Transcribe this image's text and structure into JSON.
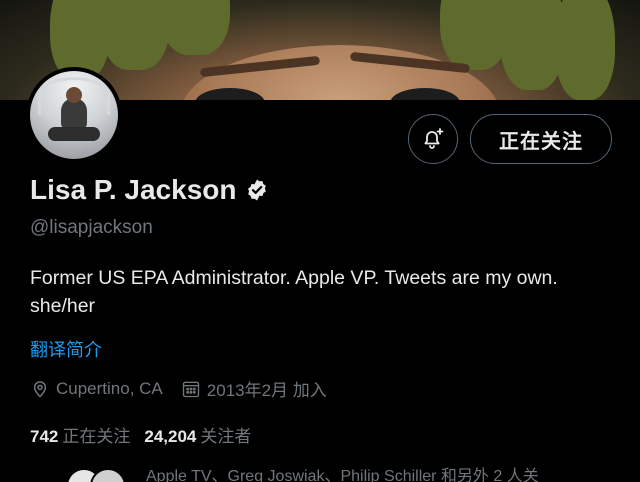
{
  "profile": {
    "name": "Lisa P. Jackson",
    "handle": "@lisapjackson",
    "bio": "Former US EPA Administrator. Apple VP. Tweets are my own. she/her",
    "translate_label": "翻译简介",
    "location": "Cupertino, CA",
    "joined": "2013年2月 加入",
    "following_count": "742",
    "following_label": "正在关注",
    "followers_count": "24,204",
    "followers_label": "关注者",
    "followed_by_text": "Apple TV、Greg Joswiak、Philip Schiller 和另外 2 人关"
  },
  "actions": {
    "follow_state_label": "正在关注",
    "notify_icon": "bell-plus-icon"
  },
  "icons": {
    "verified": "verified-badge-icon",
    "location": "location-pin-icon",
    "calendar": "calendar-icon"
  },
  "colors": {
    "background": "#000000",
    "primary_text": "#e7e9ea",
    "secondary_text": "#71767b",
    "link": "#1d9bf0",
    "button_border": "#536471"
  }
}
